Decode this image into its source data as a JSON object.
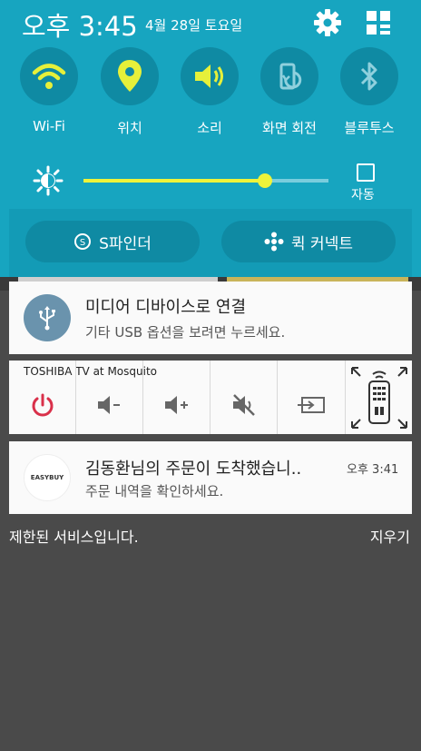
{
  "status": {
    "time": "오후 3:45",
    "date": "4월 28일 토요일"
  },
  "toggles": [
    {
      "label": "Wi-Fi",
      "icon": "wifi-icon",
      "active": true
    },
    {
      "label": "위치",
      "icon": "location-icon",
      "active": true
    },
    {
      "label": "소리",
      "icon": "sound-icon",
      "active": true
    },
    {
      "label": "화면 회전",
      "icon": "rotate-icon",
      "active": false
    },
    {
      "label": "블루투스",
      "icon": "bluetooth-icon",
      "active": false
    }
  ],
  "brightness": {
    "level": 0.74,
    "auto_label": "자동"
  },
  "pills": {
    "finder": "S파인더",
    "connect": "퀵 커넥트"
  },
  "usb_notification": {
    "title": "미디어 디바이스로 연결",
    "subtitle": "기타 USB 옵션을 보려면 누르세요."
  },
  "remote": {
    "title": "TOSHIBA TV at Mosquito"
  },
  "order_notification": {
    "title": "김동환님의 주문이 도착했습니..",
    "subtitle": "주문 내역을 확인하세요.",
    "time": "오후 3:41",
    "logo_text": "EASYBUY"
  },
  "footer": {
    "left": "제한된 서비스입니다.",
    "right": "지우기"
  },
  "colors": {
    "panel": "#17a5c0",
    "active_icon": "#e6f03a",
    "inactive_icon": "#8fd0dd",
    "power": "#d9304a"
  }
}
